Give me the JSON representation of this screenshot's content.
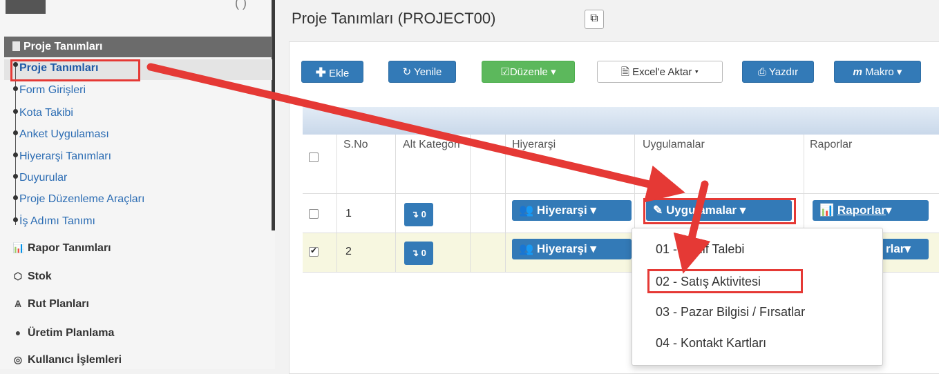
{
  "sidebar": {
    "section_title": "Proje Tanımları",
    "subitems": [
      {
        "label": "Proje Tanımları"
      },
      {
        "label": "Form Girişleri"
      },
      {
        "label": "Kota Takibi"
      },
      {
        "label": "Anket Uygulaması"
      },
      {
        "label": "Hiyerarşi Tanımları"
      },
      {
        "label": "Duyurular"
      },
      {
        "label": "Proje Düzenleme Araçları"
      },
      {
        "label": "İş Adımı Tanımı"
      }
    ],
    "main_items": [
      {
        "label": "Rapor Tanımları",
        "icon": "bar-chart-icon"
      },
      {
        "label": "Stok",
        "icon": "box-icon"
      },
      {
        "label": "Rut Planları",
        "icon": "route-icon"
      },
      {
        "label": "Üretim Planlama",
        "icon": "production-icon"
      },
      {
        "label": "Kullanıcı İşlemleri",
        "icon": "user-icon"
      }
    ]
  },
  "header": {
    "title": "Proje Tanımları (PROJECT00)"
  },
  "toolbar": {
    "add": "Ekle",
    "refresh": "Yenile",
    "edit": "Düzenle",
    "excel": "Excel'e Aktar",
    "print": "Yazdır",
    "macro": "Makro"
  },
  "table": {
    "columns": [
      "S.No",
      "Alt Kategori",
      "Hiyerarşi",
      "Uygulamalar",
      "Raporlar"
    ],
    "rows": [
      {
        "sno": "1",
        "count": "0",
        "checked": false
      },
      {
        "sno": "2",
        "count": "0",
        "checked": true
      }
    ],
    "btn_hierarchy": "Hiyerarşi",
    "btn_apps": "Uygulamalar",
    "btn_reports": "Raporlar",
    "btn_reports_partial": "rlar"
  },
  "dropdown": {
    "items": [
      "01 - Teklif Talebi",
      "02 - Satış Aktivitesi",
      "03 - Pazar Bilgisi / Fırsatlar",
      "04 - Kontakt Kartları"
    ]
  },
  "colors": {
    "primary": "#337ab7",
    "success": "#5cb85c",
    "annotation": "#e53935"
  }
}
